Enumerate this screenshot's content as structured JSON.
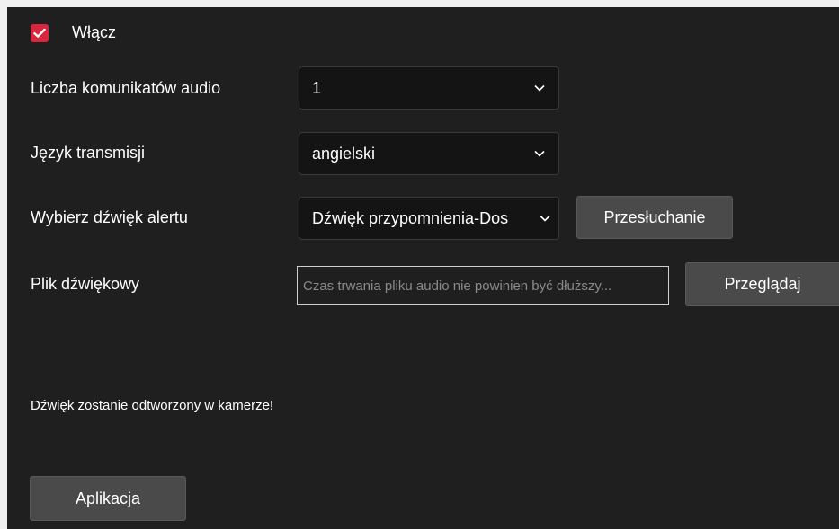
{
  "enable": {
    "label": "Włącz",
    "checked": true
  },
  "fields": {
    "audio_count": {
      "label": "Liczba komunikatów audio",
      "value": "1"
    },
    "language": {
      "label": "Język transmisji",
      "value": "angielski"
    },
    "alert_sound": {
      "label": "Wybierz dźwięk alertu",
      "value": "Dźwięk przypomnienia-Dos"
    },
    "sound_file": {
      "label": "Plik dźwiękowy",
      "placeholder": "Czas trwania pliku audio nie powinien być dłuższy..."
    }
  },
  "buttons": {
    "listen": "Przesłuchanie",
    "browse": "Przeglądaj",
    "apply": "Aplikacja"
  },
  "note": "Dźwięk zostanie odtworzony w kamerze!",
  "colors": {
    "accent": "#d7263d",
    "background": "#1f1f1f",
    "button": "#4a4a4a"
  },
  "icons": {
    "checkbox": "checkmark-icon",
    "dropdown": "chevron-down-icon"
  }
}
